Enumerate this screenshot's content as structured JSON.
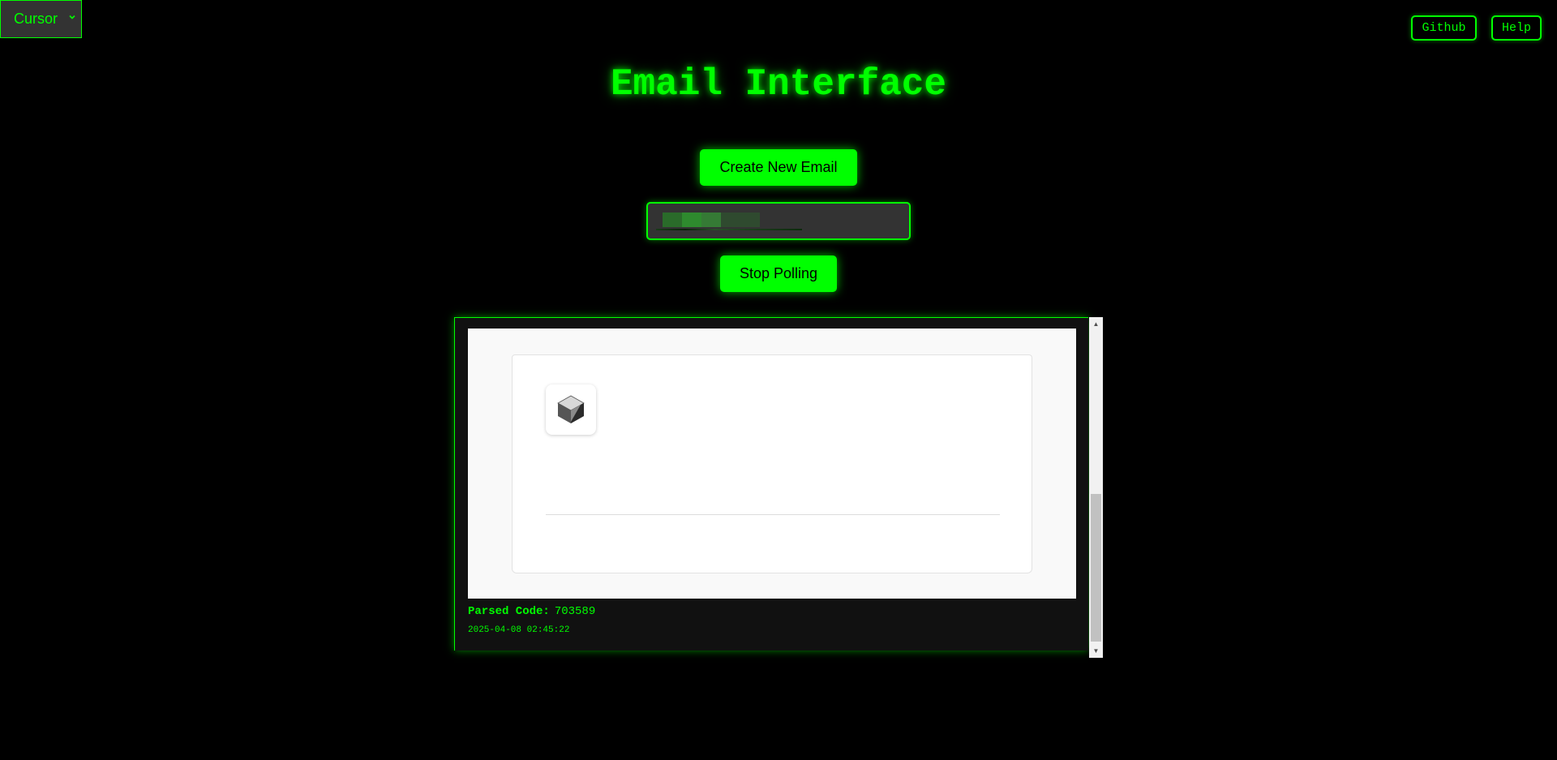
{
  "app_selector": {
    "value": "Cursor"
  },
  "header": {
    "github_label": "Github",
    "help_label": "Help"
  },
  "title": "Email Interface",
  "actions": {
    "create_label": "Create New Email",
    "stop_label": "Stop Polling"
  },
  "email_field": {
    "value_redacted": true
  },
  "email": {
    "parsed_code_label": "Parsed Code:",
    "parsed_code_value": "703589",
    "timestamp": "2025-04-08 02:45:22"
  },
  "colors": {
    "accent": "#00ff00",
    "background": "#000000",
    "field_bg": "#333333"
  },
  "icons": {
    "dropdown": "chevron-down-icon",
    "mail_logo": "cube-logo-icon"
  }
}
